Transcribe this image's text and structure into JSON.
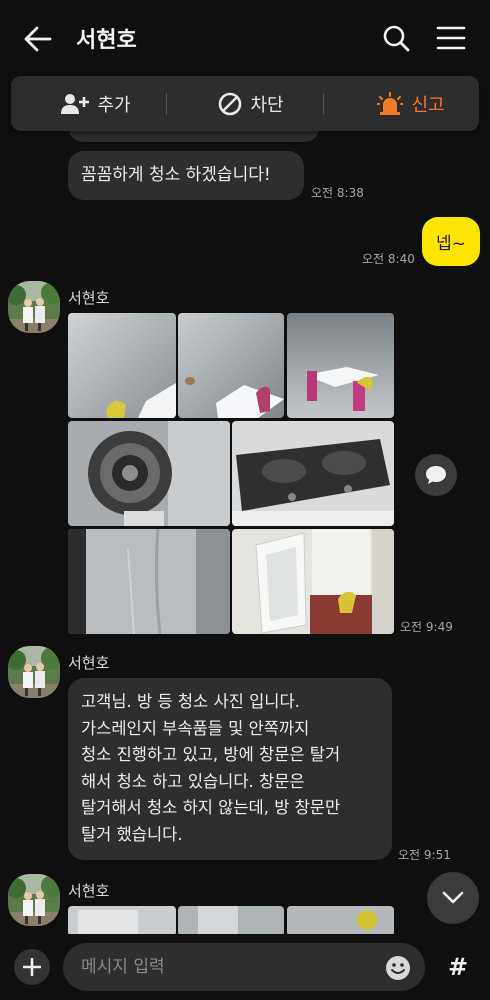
{
  "header": {
    "title": "서현호"
  },
  "actions": {
    "add": "추가",
    "block": "차단",
    "report": "신고"
  },
  "messages": {
    "m1_text": "꼼꼼하게 청소 하겠습니다!",
    "m1_time": "오전 8:38",
    "m2_text": "넵~",
    "m2_time": "오전 8:40",
    "sender_name": "서현호",
    "photos_time": "오전 9:49",
    "m3_lines": [
      "고객님. 방 등 청소 사진 입니다.",
      "가스레인지 부속품들 및 안쪽까지",
      "청소 진행하고 있고, 방에 창문은 탈거",
      "해서 청소 하고 있습니다. 창문은",
      "탈거해서 청소 하지 않는데, 방 창문만",
      "탈거 했습니다."
    ],
    "m3_time": "오전 9:51"
  },
  "input": {
    "placeholder": "메시지 입력",
    "hash": "#"
  },
  "colors": {
    "report": "#f47b2a",
    "my_bubble": "#fee500",
    "bubble": "#2e2e2e",
    "bg": "#0f0f0f"
  }
}
